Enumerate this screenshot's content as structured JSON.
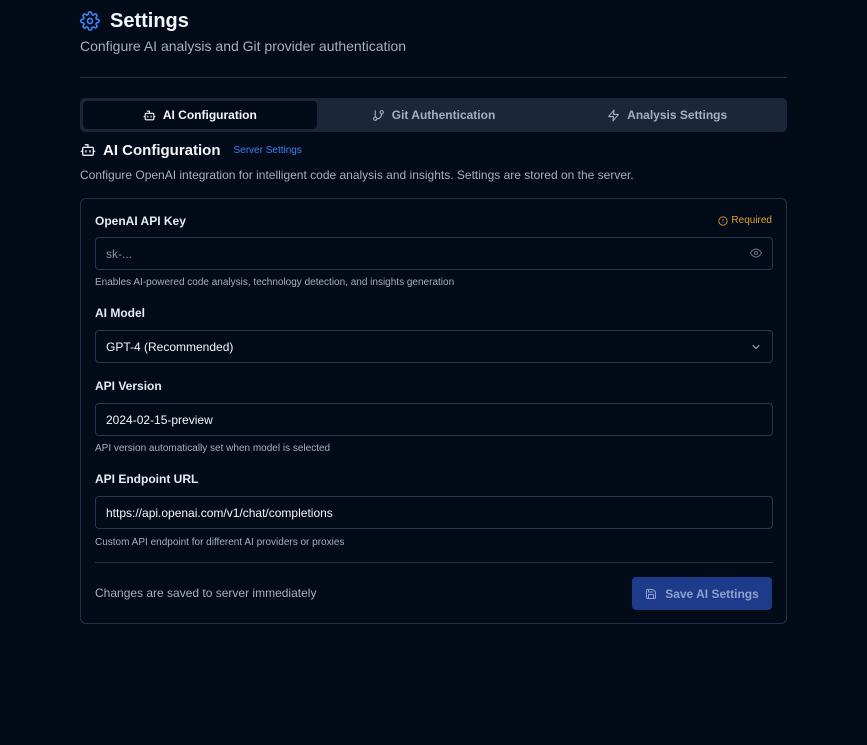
{
  "colors": {
    "background": "#030a18",
    "accent": "#3b82f6",
    "warning": "#e0a030",
    "button": "#1e3a8a",
    "border": "#223047"
  },
  "header": {
    "icon": "gear-icon",
    "title": "Settings",
    "subtitle": "Configure AI analysis and Git provider authentication"
  },
  "tabs": [
    {
      "icon": "bot-icon",
      "label": "AI Configuration",
      "active": true
    },
    {
      "icon": "git-branch-icon",
      "label": "Git Authentication",
      "active": false
    },
    {
      "icon": "lightning-icon",
      "label": "Analysis Settings",
      "active": false
    }
  ],
  "section": {
    "icon": "bot-icon",
    "title": "AI Configuration",
    "badge": "Server Settings",
    "description": "Configure OpenAI integration for intelligent code analysis and insights. Settings are stored on the server."
  },
  "form": {
    "api_key": {
      "label": "OpenAI API Key",
      "required_label": "Required",
      "required_icon": "alert-circle-icon",
      "placeholder": "sk-...",
      "value": "",
      "toggle_icon": "eye-icon",
      "help": "Enables AI-powered code analysis, technology detection, and insights generation"
    },
    "model": {
      "label": "AI Model",
      "selected": "GPT-4 (Recommended)",
      "icon": "chevron-down-icon"
    },
    "api_version": {
      "label": "API Version",
      "value": "2024-02-15-preview",
      "help": "API version automatically set when model is selected"
    },
    "endpoint": {
      "label": "API Endpoint URL",
      "value": "https://api.openai.com/v1/chat/completions",
      "help": "Custom API endpoint for different AI providers or proxies"
    }
  },
  "footer": {
    "note": "Changes are saved to server immediately",
    "save_label": "Save AI Settings",
    "save_icon": "save-icon"
  }
}
